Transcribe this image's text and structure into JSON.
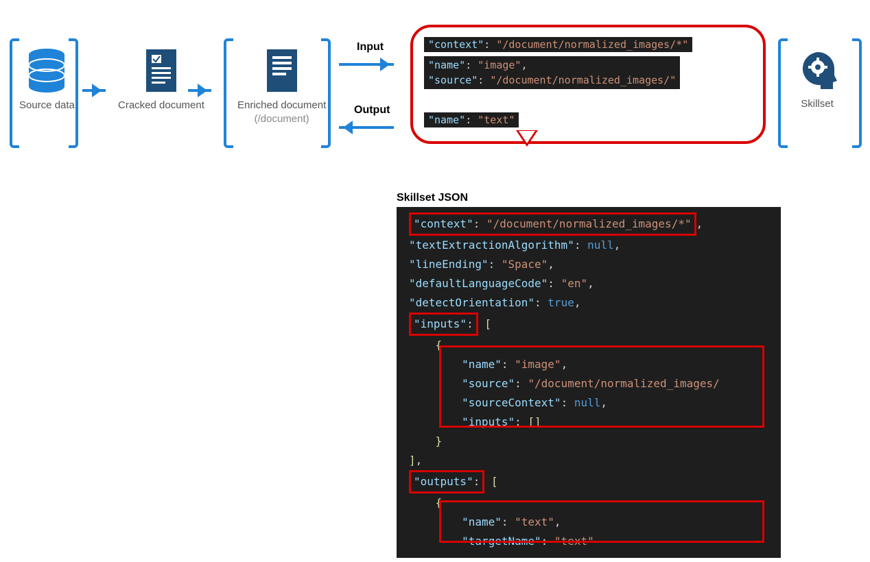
{
  "diagram": {
    "stages": {
      "source": {
        "label": "Source data"
      },
      "cracked": {
        "label": "Cracked document"
      },
      "enriched": {
        "label": "Enriched document",
        "sublabel": "(/document)"
      },
      "skillset": {
        "label": "Skillset"
      }
    },
    "flow": {
      "input": "Input",
      "output": "Output"
    }
  },
  "bubble": {
    "line1": {
      "key": "\"context\"",
      "sep": ": ",
      "val": "\"/document/normalized_images/*\""
    },
    "line2a": {
      "key": "\"name\"",
      "sep": ": ",
      "val": "\"image\"",
      "comma": ","
    },
    "line2b": {
      "key": "\"source\"",
      "sep": ": ",
      "val": "\"/document/normalized_images/\""
    },
    "line3": {
      "key": "\"name\"",
      "sep": ": ",
      "val": "\"text\""
    }
  },
  "jsonPanel": {
    "title": "Skillset JSON",
    "lines": {
      "l1": {
        "key": "\"context\"",
        "sep": ": ",
        "val": "\"/document/normalized_images/*\"",
        "comma": ","
      },
      "l2": {
        "key": "\"textExtractionAlgorithm\"",
        "sep": ": ",
        "val": "null",
        "comma": ","
      },
      "l3": {
        "key": "\"lineEnding\"",
        "sep": ": ",
        "val": "\"Space\"",
        "comma": ","
      },
      "l4": {
        "key": "\"defaultLanguageCode\"",
        "sep": ": ",
        "val": "\"en\"",
        "comma": ","
      },
      "l5": {
        "key": "\"detectOrientation\"",
        "sep": ": ",
        "val": "true",
        "comma": ","
      },
      "l6": {
        "key": "\"inputs\"",
        "sep": ": ["
      },
      "l7": {
        "brace": "{"
      },
      "l8": {
        "key": "\"name\"",
        "sep": ": ",
        "val": "\"image\"",
        "comma": ","
      },
      "l9": {
        "key": "\"source\"",
        "sep": ": ",
        "val": "\"/document/normalized_images/"
      },
      "l10": {
        "key": "\"sourceContext\"",
        "sep": ": ",
        "val": "null",
        "comma": ","
      },
      "l11": {
        "key": "\"inputs\"",
        "sep": ": []"
      },
      "l12": {
        "brace": "}"
      },
      "l13": {
        "brace": "],"
      },
      "l14": {
        "key": "\"outputs\"",
        "sep": ": ["
      },
      "l15": {
        "brace": "{"
      },
      "l16": {
        "key": "\"name\"",
        "sep": ": ",
        "val": "\"text\"",
        "comma": ","
      },
      "l17": {
        "key": "\"targetName\"",
        "sep": ": ",
        "val": "\"text\""
      }
    }
  }
}
